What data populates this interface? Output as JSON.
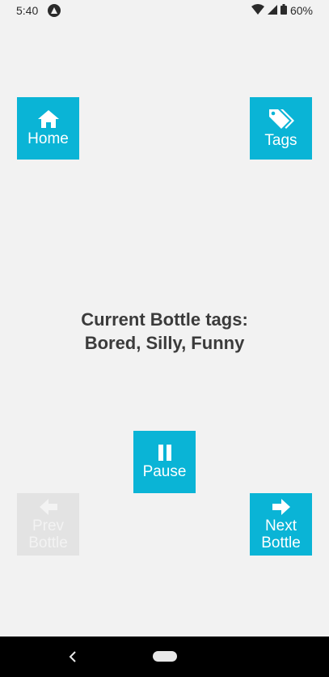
{
  "status_bar": {
    "time": "5:40",
    "battery": "60%",
    "icons": [
      "app-notification-icon",
      "wifi-icon",
      "cell-signal-icon",
      "battery-icon"
    ]
  },
  "buttons": {
    "home": {
      "label": "Home",
      "icon": "home-icon"
    },
    "tags": {
      "label": "Tags",
      "icon": "tags-icon"
    },
    "pause": {
      "label": "Pause",
      "icon": "pause-icon"
    },
    "prev": {
      "label_line1": "Prev",
      "label_line2": "Bottle",
      "icon": "arrow-left-icon",
      "enabled": false
    },
    "next": {
      "label_line1": "Next",
      "label_line2": "Bottle",
      "icon": "arrow-right-icon",
      "enabled": true
    }
  },
  "main": {
    "tags_heading": "Current Bottle tags:",
    "tags_value": "Bored, Silly, Funny"
  },
  "nav_bar": {
    "icons": [
      "back-icon",
      "home-pill-icon"
    ]
  },
  "colors": {
    "accent": "#0ab4d6",
    "disabled": "#e3e3e3",
    "background": "#f2f2f2",
    "text": "#3b3b3b"
  }
}
